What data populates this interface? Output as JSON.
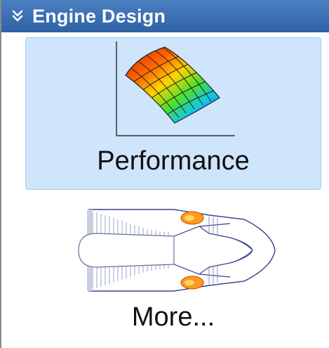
{
  "section": {
    "title": "Engine Design",
    "header_color": "#3a6db0"
  },
  "tiles": [
    {
      "label": "Performance",
      "icon": "performance-surface-plot-icon",
      "selected": true,
      "highlight_color": "#cfe5fb"
    },
    {
      "label": "More...",
      "icon": "jet-engine-cross-section-icon",
      "selected": false
    }
  ]
}
